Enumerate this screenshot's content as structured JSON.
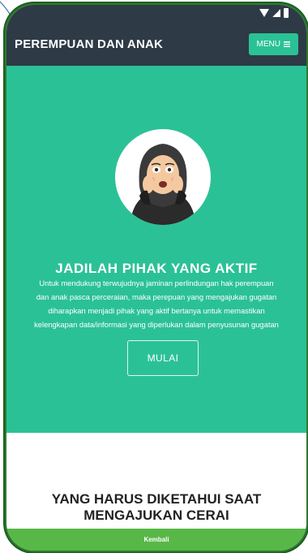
{
  "header": {
    "title": "PEREMPUAN DAN ANAK",
    "menu_label": "MENU"
  },
  "hero": {
    "title": "JADILAH PIHAK YANG AKTIF",
    "lines": [
      "Untuk mendukung terwujudnya jaminan perlindungan hak perempuan",
      "dan anak pasca perceraian, maka perepuan yang mengajukan gugatan",
      "diharapkan menjadi pihak yang aktif bertanya untuk memastikan",
      "kelengkapan data/informasi yang diperlukan dalam penyusunan gugatan"
    ],
    "start_label": "MULAI"
  },
  "section": {
    "title_line1": "YANG HARUS DIKETAHUI SAAT",
    "title_line2": "MENGAJUKAN CERAI"
  },
  "footer": {
    "back_label": "Kembali"
  },
  "colors": {
    "navbar": "#2e3a46",
    "accent": "#2bc196",
    "back_bar": "#58b847"
  }
}
